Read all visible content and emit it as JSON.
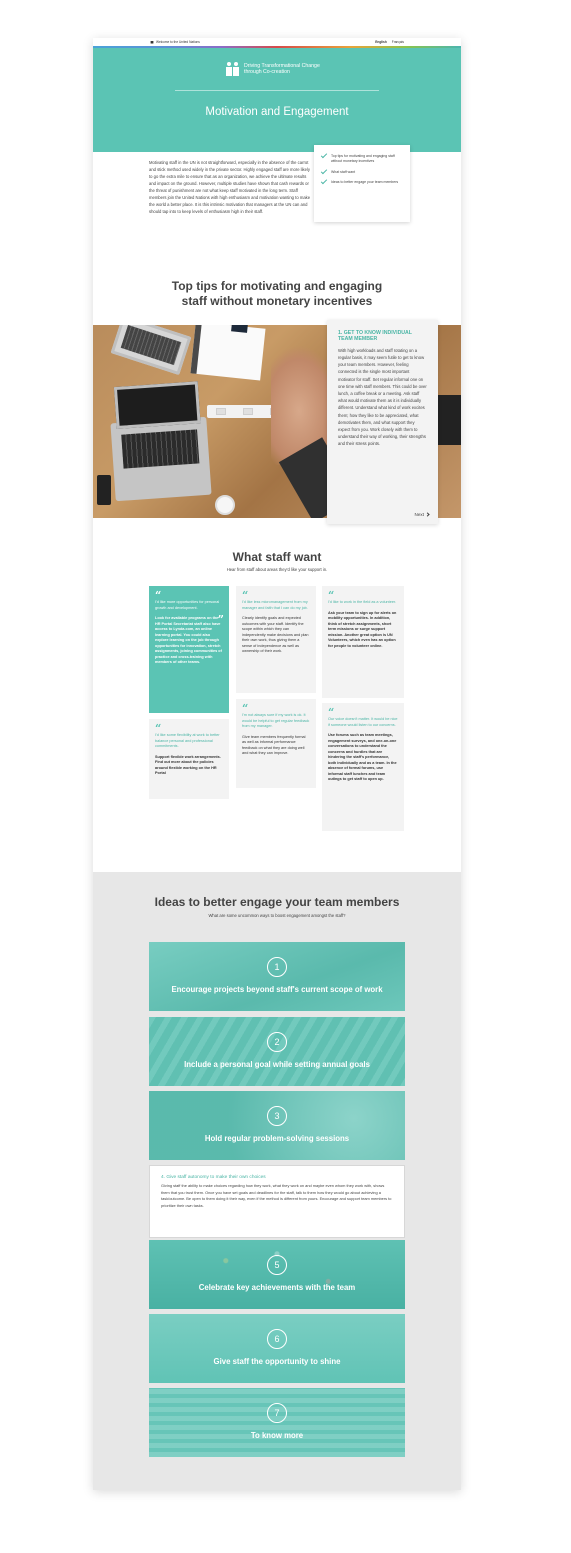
{
  "topbar": {
    "home_label": "Welcome to the United Nations",
    "languages": [
      "English",
      "Français"
    ]
  },
  "hero": {
    "logo_text": "Driving Transformational Change through Co-creation",
    "title": "Motivation and Engagement"
  },
  "intro": {
    "text": "Motivating staff in the UN is not straightforward, especially in the absence of the carrot and stick method used widely in the private sector. Highly engaged staff are more likely to go the extra mile to ensure that as an organization, we achieve the ultimate results and impact on the ground. However, multiple studies have shown that cash rewards or the threat of punishment are not what keep staff motivated in the long term. Staff members join the United Nations with high enthusiasm and motivation wanting to make the world a better place. It is this intrinsic motivation that managers at the UN can and should tap into to keep levels of enthusiasm high in their staff."
  },
  "contents": {
    "items": [
      "Top tips for motivating and engaging staff without monetary incentives",
      "What staff want",
      "Ideas to better engage your team members"
    ]
  },
  "tips": {
    "title": "Top tips for motivating and engaging staff without monetary incentives",
    "card_title": "1.  GET TO KNOW INDIVIDUAL TEAM MEMBER",
    "card_text": "With high workloads and staff rotating on a regular basis, it may seem futile to get to know your team members. However, feeling connected is the single most important motivator for staff. Set regular informal one on one time with staff members. This could be over lunch, a coffee break or a meeting. Ask staff what would motivate them as it is individually different. Understand what kind of work excites them; how they like to be appreciated, what demotivates them, and what support they expect from you. Work closely with them to understand their way of working, their strengths and their stress points.",
    "next_label": "Next"
  },
  "staff": {
    "title": "What staff want",
    "subtitle": "Hear from staff about areas they'd like your support in.",
    "quotes": [
      {
        "quote": "I'd like more opportunities for personal growth and development.",
        "answer": "Look for available programs on the HR Portal Secretariat staff also have access to Lynda.com, an online learning portal. You could also explore learning on the job through opportunities for innovation, stretch assignments, joining communities of practice and cross-training with members of other teams."
      },
      {
        "quote": "I'd like some flexibility at work to better balance personal and professional commitments.",
        "answer": "Support flexible work arrangements. Find out more about the policies around flexible working on the HR Portal"
      },
      {
        "quote": "I'd like less micromanagement from my manager and faith that I can do my job.",
        "answer": "Clearly identify goals and expected outcomes with your staff. Identify the scope within which they can independently make decisions and plan their own work, thus giving them a sense of independence as well as ownership of their work."
      },
      {
        "quote": "I'm not always sure if my work is ok. It would be helpful to get regular feedback from my manager.",
        "answer": "Give team members frequently formal as well as informal performance feedback on what they are doing well and what they can improve."
      },
      {
        "quote": "I'd like to work in the field as a volunteer.",
        "answer": "Ask your team to sign up for alerts on mobility opportunities. In addition, think of stretch assignments, short term missions or surge support mission. Another great option is UN Volunteers, which even has an option for people to volunteer online."
      },
      {
        "quote": "Our voice doesn't matter. It would be nice if someone would listen to our concerns.",
        "answer": "Use forums such as team meetings, engagement surveys, and one-on-one conversations to understand the concerns and hurdles that are hindering the staff's performance, both individually and as a team. In the absence of formal forums, use informal staff lunches and team outings to get staff to open up."
      }
    ]
  },
  "ideas": {
    "title": "Ideas to better engage your team members",
    "subtitle": "What are some uncommon ways to boost engagement amongst the staff?",
    "items": [
      {
        "num": "1",
        "label": "Encourage projects beyond staff's current scope of work"
      },
      {
        "num": "2",
        "label": "Include a personal goal while setting annual goals"
      },
      {
        "num": "3",
        "label": "Hold regular problem-solving sessions"
      },
      {
        "num": "5",
        "label": "Celebrate key achievements with the team"
      },
      {
        "num": "6",
        "label": "Give staff the opportunity to shine"
      },
      {
        "num": "7",
        "label": "To know more"
      }
    ],
    "open_item": {
      "title": "4. Give staff autonomy to make their own choices",
      "text": "Giving staff the ability to make choices regarding how they work, what they work on and maybe even whom they work with, shows them that you trust them. Once you have set goals and deadlines for the staff, talk to them how they would go about achieving a task/outcome. Be open to them doing it their way, even if the method is different from yours. Encourage and support team members to prioritize their own tasks."
    }
  },
  "colors": {
    "brand_teal": "#5bc4b4",
    "heading_teal": "#4ab5a5",
    "section_grey": "#e7e7e7"
  }
}
